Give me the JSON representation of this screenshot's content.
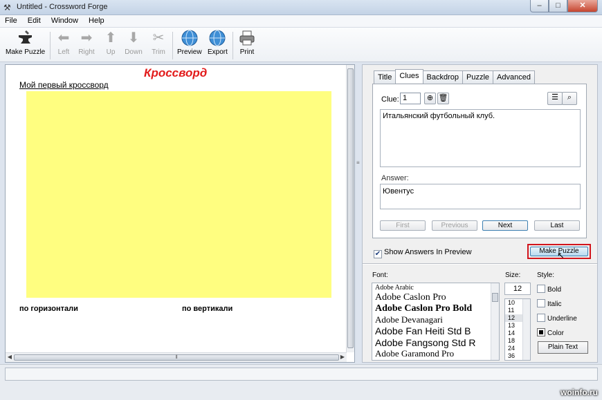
{
  "window": {
    "title": "Untitled - Crossword Forge",
    "controls": {
      "minimize": "–",
      "maximize": "□",
      "close": "✕"
    }
  },
  "menu": [
    "File",
    "Edit",
    "Window",
    "Help"
  ],
  "toolbar": {
    "make_puzzle": "Make Puzzle",
    "left": "Left",
    "right": "Right",
    "up": "Up",
    "down": "Down",
    "trim": "Trim",
    "preview": "Preview",
    "export": "Export",
    "print": "Print"
  },
  "document": {
    "title": "Кроссворд",
    "subtitle": "Мой первый кроссворд",
    "across_heading": "по горизонтали",
    "down_heading": "по вертикали",
    "grid_color": "#fffe80"
  },
  "tabs": [
    {
      "label": "Title",
      "active": false
    },
    {
      "label": "Clues",
      "active": true
    },
    {
      "label": "Backdrop",
      "active": false
    },
    {
      "label": "Puzzle",
      "active": false
    },
    {
      "label": "Advanced",
      "active": false
    }
  ],
  "clues": {
    "clue_label": "Clue:",
    "clue_number": "1",
    "clue_text": "Итальянский футбольный клуб.",
    "answer_label": "Answer:",
    "answer_text": "Ювентус",
    "nav": {
      "first": "First",
      "previous": "Previous",
      "next": "Next",
      "last": "Last"
    }
  },
  "preview_options": {
    "show_answers_label": "Show Answers In Preview",
    "show_answers_checked": true,
    "make_puzzle_button": "Make Puzzle"
  },
  "font_panel": {
    "font_label": "Font:",
    "size_label": "Size:",
    "style_label": "Style:",
    "fonts": [
      "Adobe Arabic",
      "Adobe Caslon Pro",
      "Adobe Caslon Pro Bold",
      "Adobe Devanagari",
      "Adobe Fan Heiti Std B",
      "Adobe Fangsong Std R",
      "Adobe Garamond Pro"
    ],
    "size_value": "12",
    "sizes": [
      "10",
      "11",
      "12",
      "13",
      "14",
      "18",
      "24",
      "36"
    ],
    "selected_size": "12",
    "styles": {
      "bold": "Bold",
      "italic": "Italic",
      "underline": "Underline",
      "color": "Color"
    },
    "plain_text_button": "Plain Text"
  },
  "watermark": "woinfo.ru"
}
